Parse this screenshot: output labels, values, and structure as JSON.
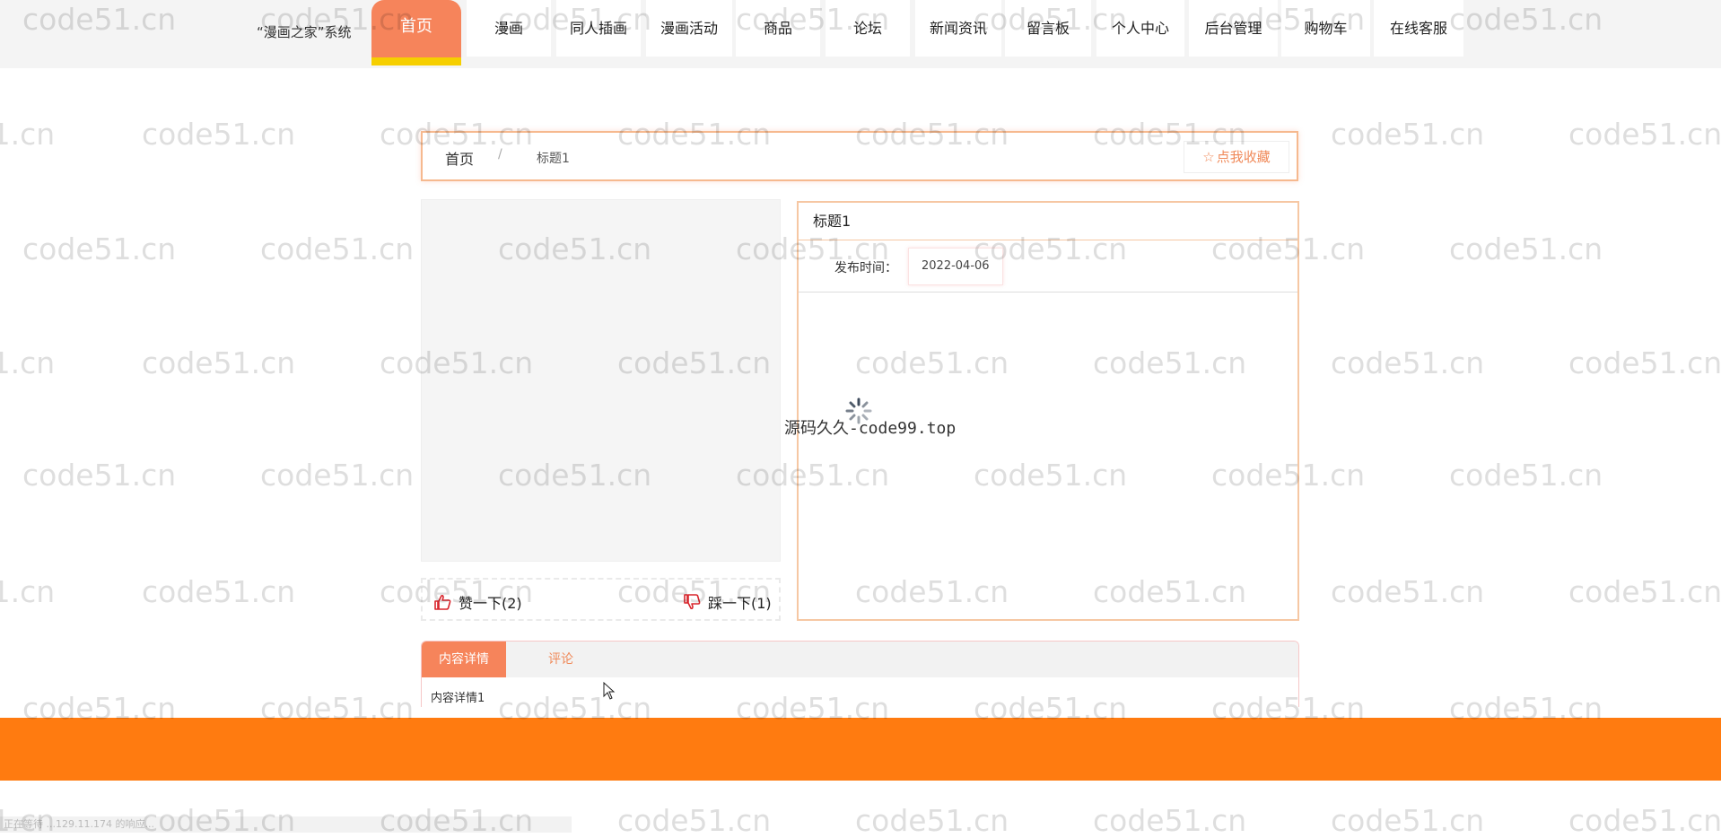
{
  "nav": {
    "brand": "“漫画之家”系统",
    "items": [
      {
        "label": "首页"
      },
      {
        "label": "漫画"
      },
      {
        "label": "同人插画"
      },
      {
        "label": "漫画活动"
      },
      {
        "label": "商品"
      },
      {
        "label": "论坛"
      },
      {
        "label": "新闻资讯"
      },
      {
        "label": "留言板"
      },
      {
        "label": "个人中心"
      },
      {
        "label": "后台管理"
      },
      {
        "label": "购物车"
      },
      {
        "label": "在线客服"
      }
    ],
    "active_index": 0
  },
  "breadcrumb": {
    "home": "首页",
    "separator": "/",
    "current": "标题1",
    "favorite_label": "点我收藏",
    "favorite_icon": "star-icon"
  },
  "votes": {
    "like_label": "赞一下(2)",
    "like_icon": "thumbs-up-icon",
    "dislike_label": "踩一下(1)",
    "dislike_icon": "thumbs-down-icon"
  },
  "detail": {
    "title": "标题1",
    "publish_label": "发布时间：",
    "publish_value": "2022-04-06"
  },
  "loading": {
    "text": "源码久久-code99.top",
    "icon": "spinner-icon"
  },
  "tabs": [
    {
      "label": "内容详情"
    },
    {
      "label": "评论"
    }
  ],
  "tab_content": "内容详情1",
  "status_bar": "正在等待 ...129.11.174 的响应...",
  "watermark": "code51.cn",
  "colors": {
    "accent": "#f6845b",
    "active_underline": "#f6cf00",
    "footer": "#ff7b10",
    "panel_border": "#f6c7a3"
  }
}
